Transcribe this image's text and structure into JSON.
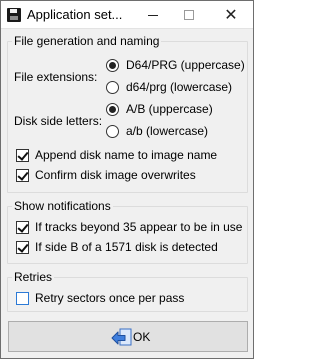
{
  "window": {
    "title": "Application set...",
    "icon": "floppy-disk-icon"
  },
  "titlebar": {
    "minimize_icon": "minimize-icon",
    "maximize_icon": "maximize-icon",
    "close_icon": "close-icon",
    "close_glyph": "✕"
  },
  "file_group": {
    "title": "File generation and naming",
    "file_extensions_label": "File extensions:",
    "file_extension_options": [
      {
        "label": "D64/PRG (uppercase)",
        "checked": true
      },
      {
        "label": "d64/prg (lowercase)",
        "checked": false
      }
    ],
    "disk_side_label": "Disk side letters:",
    "disk_side_options": [
      {
        "label": "A/B (uppercase)",
        "checked": true
      },
      {
        "label": "a/b (lowercase)",
        "checked": false
      }
    ],
    "append_disk_name": {
      "label": "Append disk name to image name",
      "checked": true
    },
    "confirm_overwrites": {
      "label": "Confirm disk image overwrites",
      "checked": true
    }
  },
  "notifications_group": {
    "title": "Show notifications",
    "items": [
      {
        "label": "If tracks beyond 35 appear to be in use",
        "checked": true
      },
      {
        "label": "If side B of a 1571 disk is detected",
        "checked": true
      }
    ]
  },
  "retries_group": {
    "title": "Retries",
    "retry_once": {
      "label": "Retry sectors once per pass",
      "checked": false
    }
  },
  "ok_button": {
    "label": "OK",
    "icon": "enter-arrow-icon"
  },
  "colors": {
    "window_bg": "#f0f0f0",
    "titlebar_bg": "#ffffff",
    "focus_blue": "#2c7ad6"
  }
}
